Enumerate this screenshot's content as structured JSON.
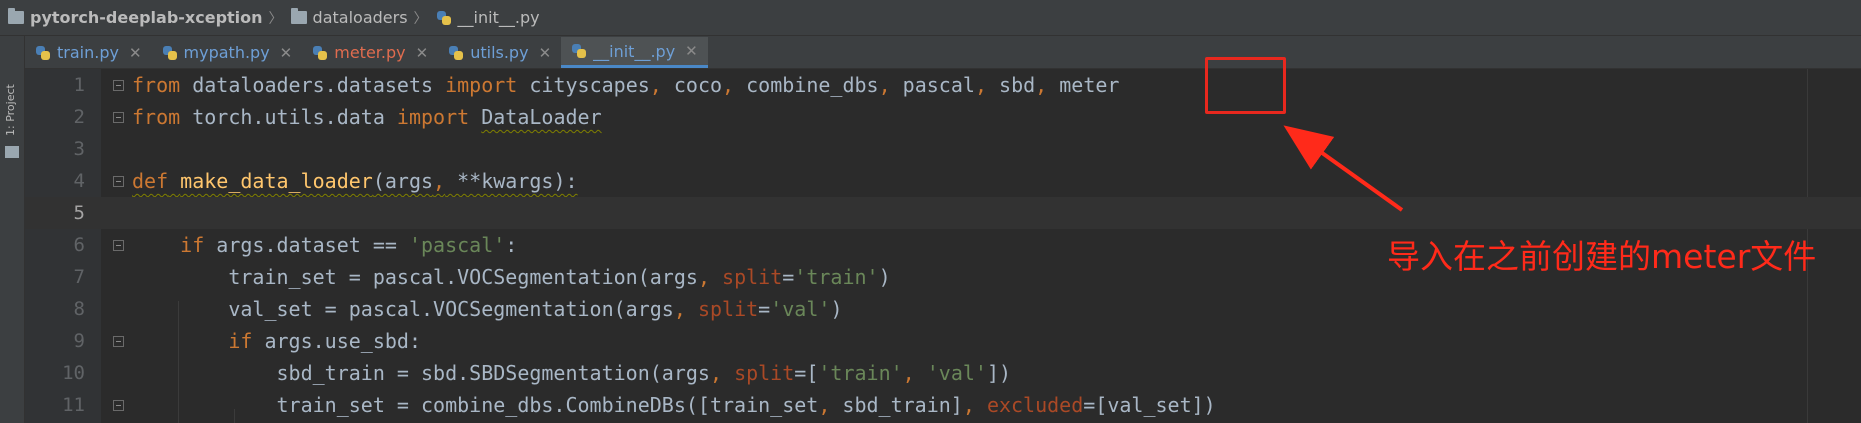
{
  "breadcrumb": {
    "project": "pytorch-deeplab-xception",
    "folder": "dataloaders",
    "file": "__init__.py"
  },
  "sidebar": {
    "project_tool": "1: Project"
  },
  "tabs": [
    {
      "label": "train.py",
      "state": "normal"
    },
    {
      "label": "mypath.py",
      "state": "normal"
    },
    {
      "label": "meter.py",
      "state": "modified"
    },
    {
      "label": "utils.py",
      "state": "normal"
    },
    {
      "label": "__init__.py",
      "state": "active"
    }
  ],
  "editor": {
    "current_line": 5,
    "lines": [
      {
        "n": "1",
        "text": "from dataloaders.datasets import cityscapes, coco, combine_dbs, pascal, sbd, meter"
      },
      {
        "n": "2",
        "text": "from torch.utils.data import DataLoader"
      },
      {
        "n": "3",
        "text": ""
      },
      {
        "n": "4",
        "text": "def make_data_loader(args, **kwargs):"
      },
      {
        "n": "5",
        "text": ""
      },
      {
        "n": "6",
        "text": "    if args.dataset == 'pascal':"
      },
      {
        "n": "7",
        "text": "        train_set = pascal.VOCSegmentation(args, split='train')"
      },
      {
        "n": "8",
        "text": "        val_set = pascal.VOCSegmentation(args, split='val')"
      },
      {
        "n": "9",
        "text": "        if args.use_sbd:"
      },
      {
        "n": "10",
        "text": "            sbd_train = sbd.SBDSegmentation(args, split=['train', 'val'])"
      },
      {
        "n": "11",
        "text": "            train_set = combine_dbs.CombineDBs([train_set, sbd_train], excluded=[val_set])"
      }
    ]
  },
  "annotation": {
    "text": "导入在之前创建的meter文件",
    "color": "#ff2a1a"
  },
  "colors": {
    "keyword": "#cc7832",
    "function": "#ffc66d",
    "string": "#6a8759",
    "kwarg": "#aa4926",
    "default": "#a9b7c6",
    "background": "#2b2b2b"
  }
}
